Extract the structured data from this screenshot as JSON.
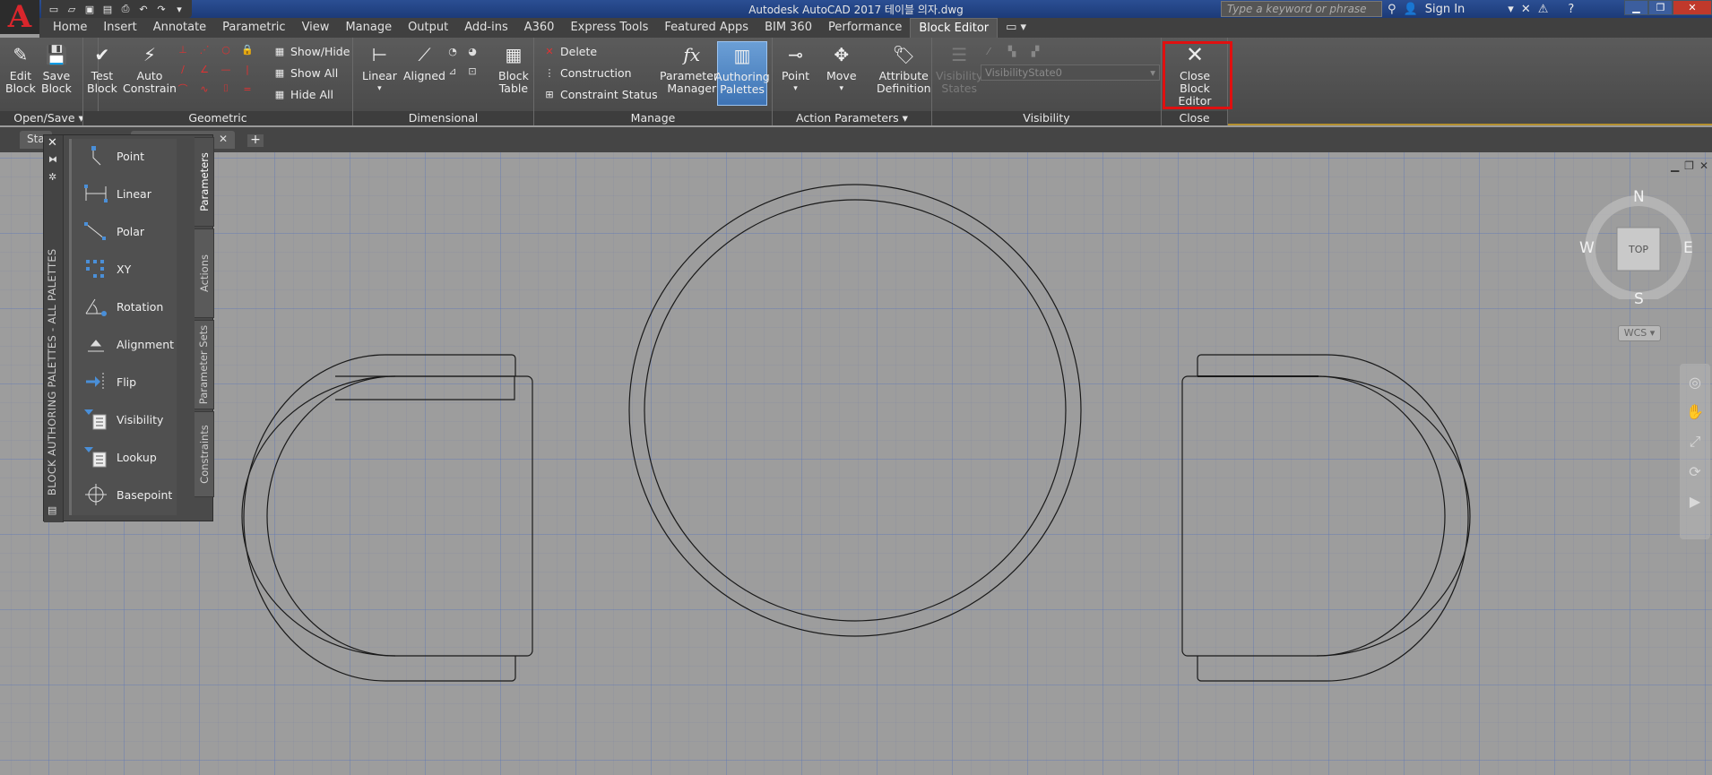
{
  "window": {
    "title": "Autodesk AutoCAD 2017    테이블 의자.dwg",
    "app_logo": "A",
    "search_placeholder": "Type a keyword or phrase",
    "sign_in": "Sign In",
    "help": "?"
  },
  "ribbon_tabs": [
    "Home",
    "Insert",
    "Annotate",
    "Parametric",
    "View",
    "Manage",
    "Output",
    "Add-ins",
    "A360",
    "Express Tools",
    "Featured Apps",
    "BIM 360",
    "Performance",
    "Block Editor"
  ],
  "ribbon": {
    "open_save": {
      "label": "Open/Save",
      "edit_block": "Edit\nBlock",
      "save_block": "Save\nBlock"
    },
    "geometric": {
      "label": "Geometric",
      "test_block": "Test\nBlock",
      "auto_constrain": "Auto\nConstrain",
      "show_hide": "Show/Hide",
      "show_all": "Show All",
      "hide_all": "Hide All"
    },
    "dimensional": {
      "label": "Dimensional",
      "linear": "Linear",
      "aligned": "Aligned",
      "block_table": "Block\nTable"
    },
    "manage": {
      "label": "Manage",
      "delete": "Delete",
      "construction": "Construction",
      "constraint_status": "Constraint Status",
      "parameters_manager": "Parameters\nManager",
      "authoring_palettes": "Authoring\nPalettes"
    },
    "action_parameters": {
      "label": "Action Parameters",
      "point": "Point",
      "move": "Move",
      "attribute_definition": "Attribute\nDefinition"
    },
    "visibility": {
      "label": "Visibility",
      "visibility_states": "Visibility\nStates",
      "state_value": "VisibilityState0"
    },
    "close": {
      "label": "Close",
      "close_block_editor": "Close\nBlock Editor"
    }
  },
  "doc_tabs": {
    "tab1": "Sta",
    "add": "+"
  },
  "palette": {
    "title": "BLOCK AUTHORING PALETTES - ALL PALETTES",
    "items": [
      "Point",
      "Linear",
      "Polar",
      "XY",
      "Rotation",
      "Alignment",
      "Flip",
      "Visibility",
      "Lookup",
      "Basepoint"
    ],
    "tabs": [
      "Parameters",
      "Actions",
      "Parameter Sets",
      "Constraints"
    ]
  },
  "viewcube": {
    "n": "N",
    "s": "S",
    "e": "E",
    "w": "W",
    "face": "TOP",
    "wcs": "WCS"
  },
  "colors": {
    "accent": "#b4902f",
    "close_highlight": "#e01010",
    "canvas": "#9d9d9d"
  }
}
